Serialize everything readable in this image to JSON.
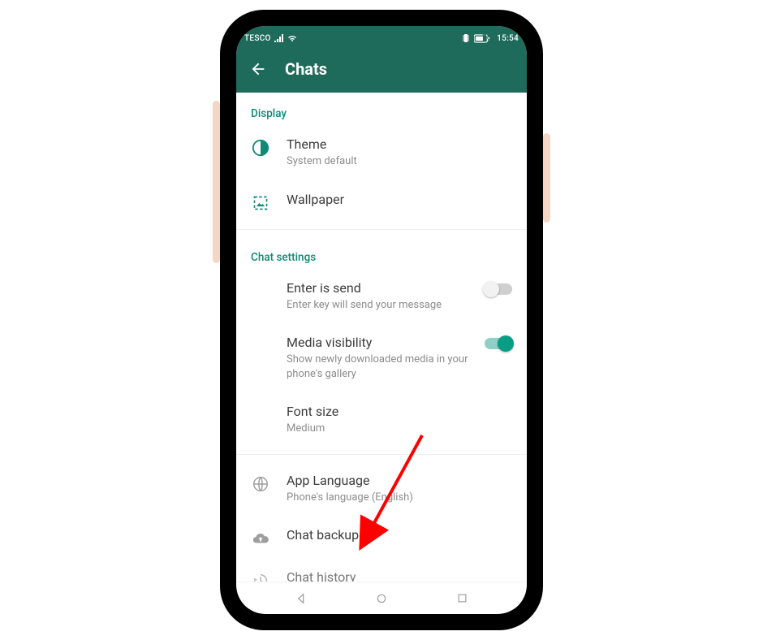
{
  "status": {
    "carrier": "TESCO",
    "battery": "76",
    "time": "15:54"
  },
  "header": {
    "title": "Chats"
  },
  "sections": {
    "display_label": "Display",
    "chat_settings_label": "Chat settings"
  },
  "rows": {
    "theme": {
      "title": "Theme",
      "subtitle": "System default"
    },
    "wallpaper": {
      "title": "Wallpaper"
    },
    "enter_send": {
      "title": "Enter is send",
      "subtitle": "Enter key will send your message"
    },
    "media_visibility": {
      "title": "Media visibility",
      "subtitle": "Show newly downloaded media in your phone's gallery"
    },
    "font_size": {
      "title": "Font size",
      "subtitle": "Medium"
    },
    "app_language": {
      "title": "App Language",
      "subtitle": "Phone's language (English)"
    },
    "chat_backup": {
      "title": "Chat backup"
    },
    "chat_history": {
      "title": "Chat history"
    }
  },
  "toggles": {
    "enter_send": false,
    "media_visibility": true
  }
}
